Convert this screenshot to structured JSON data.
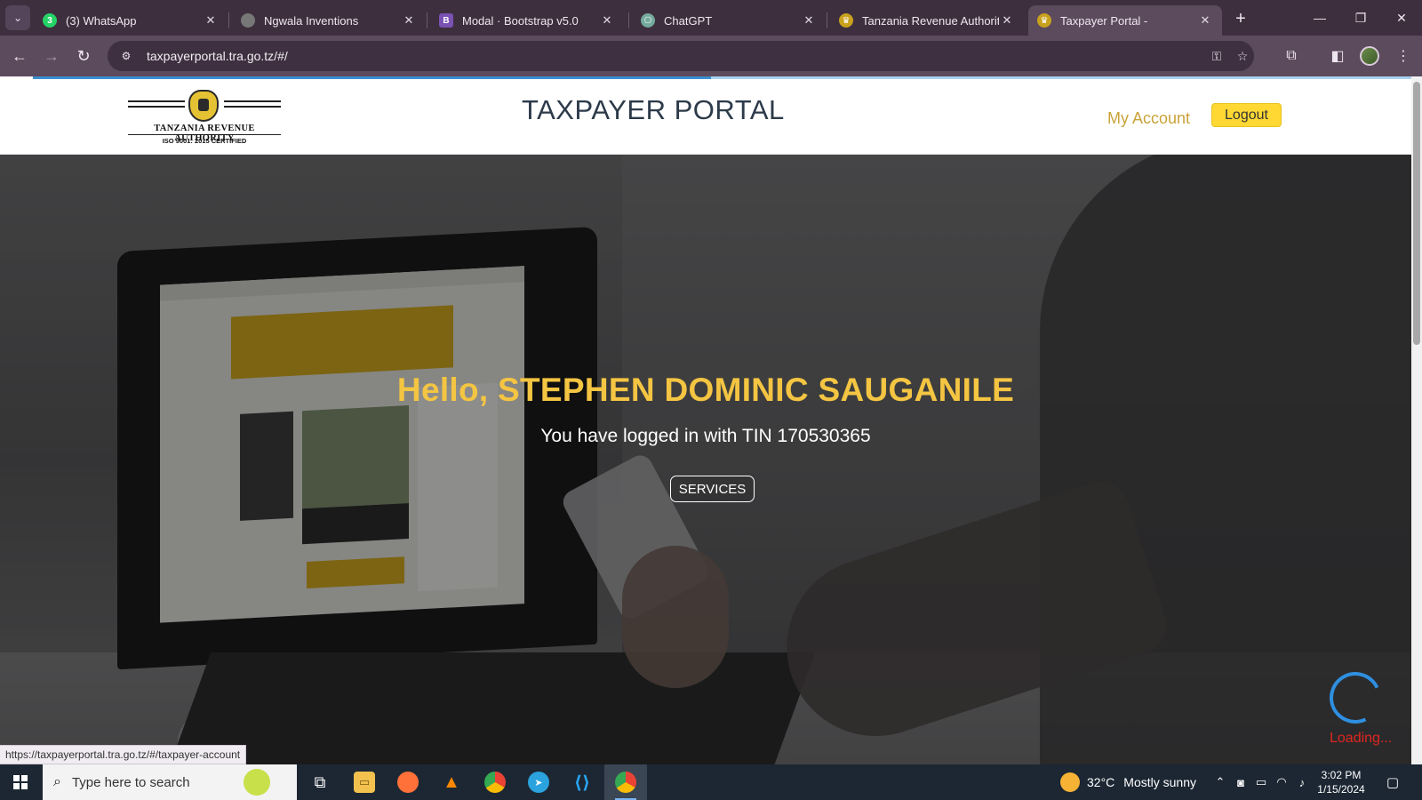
{
  "browser": {
    "tabs": [
      {
        "title": "(3) WhatsApp",
        "favicon": "whatsapp-icon",
        "favicon_color": "#25d366",
        "favicon_glyph": "3"
      },
      {
        "title": "Ngwala Inventions",
        "favicon": "globe-icon",
        "favicon_color": "#777777",
        "favicon_glyph": ""
      },
      {
        "title": "Modal · Bootstrap v5.0",
        "favicon": "bootstrap-icon",
        "favicon_color": "#7952b3",
        "favicon_glyph": "B"
      },
      {
        "title": "ChatGPT",
        "favicon": "chatgpt-icon",
        "favicon_color": "#74aa9c",
        "favicon_glyph": "⎔"
      },
      {
        "title": "Tanzania Revenue Authority",
        "favicon": "tra-emblem-icon",
        "favicon_color": "#c9a21d",
        "favicon_glyph": "♛"
      },
      {
        "title": "Taxpayer Portal -",
        "favicon": "tra-emblem-icon",
        "favicon_color": "#c9a21d",
        "favicon_glyph": "♛",
        "active": true
      }
    ],
    "url": "taxpayerportal.tra.go.tz/#/",
    "status_url": "https://taxpayerportal.tra.go.tz/#/taxpayer-account"
  },
  "site": {
    "logo_name": "TANZANIA REVENUE AUTHORITY",
    "logo_iso": "ISO 9001: 2015 CERTIFIED",
    "title": "TAXPAYER PORTAL",
    "nav": {
      "my_account": "My Account",
      "logout": "Logout"
    }
  },
  "hero": {
    "greeting": "Hello, STEPHEN DOMINIC SAUGANILE",
    "tin_message": "You have logged in with TIN 170530365",
    "services_label": "SERVICES",
    "loading_text": "Loading..."
  },
  "taskbar": {
    "search_placeholder": "Type here to search",
    "weather_temp": "32°C",
    "weather_desc": "Mostly sunny",
    "time": "3:02 PM",
    "date": "1/15/2024"
  },
  "colors": {
    "accent_yellow": "#ffd834",
    "greeting_color": "#f4c542",
    "loading_red": "#e2261f",
    "spinner_blue": "#2f8fe0"
  }
}
